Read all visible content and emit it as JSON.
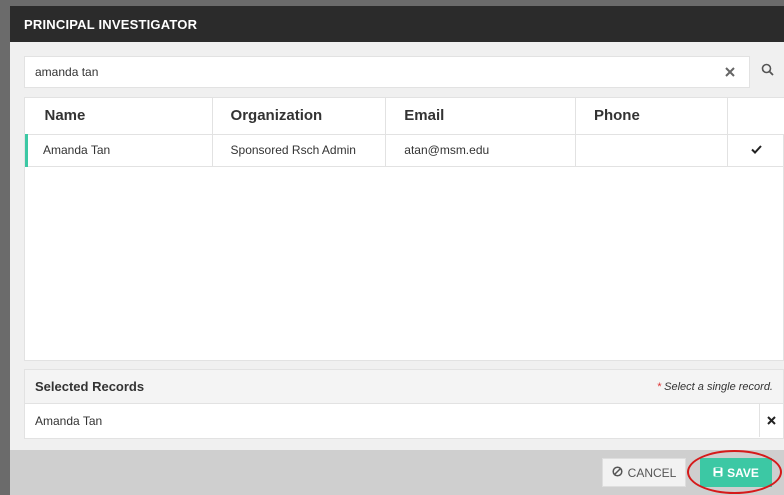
{
  "modal": {
    "title": "PRINCIPAL INVESTIGATOR"
  },
  "search": {
    "value": "amanda tan",
    "clear_icon": "close-x-icon",
    "search_icon": "search-icon"
  },
  "table": {
    "columns": [
      "Name",
      "Organization",
      "Email",
      "Phone",
      ""
    ],
    "rows": [
      {
        "name": "Amanda Tan",
        "organization": "Sponsored Rsch Admin",
        "email": "atan@msm.edu",
        "phone": "",
        "selected": true
      }
    ]
  },
  "selected_records": {
    "title": "Selected Records",
    "required_mark": "*",
    "note": "Select a single record.",
    "items": [
      {
        "name": "Amanda Tan"
      }
    ]
  },
  "footer": {
    "cancel_label": "CANCEL",
    "save_label": "SAVE"
  },
  "colors": {
    "accent": "#3cc8a4",
    "header_bg": "#2b2b2b",
    "annotation": "#d51a1a"
  }
}
